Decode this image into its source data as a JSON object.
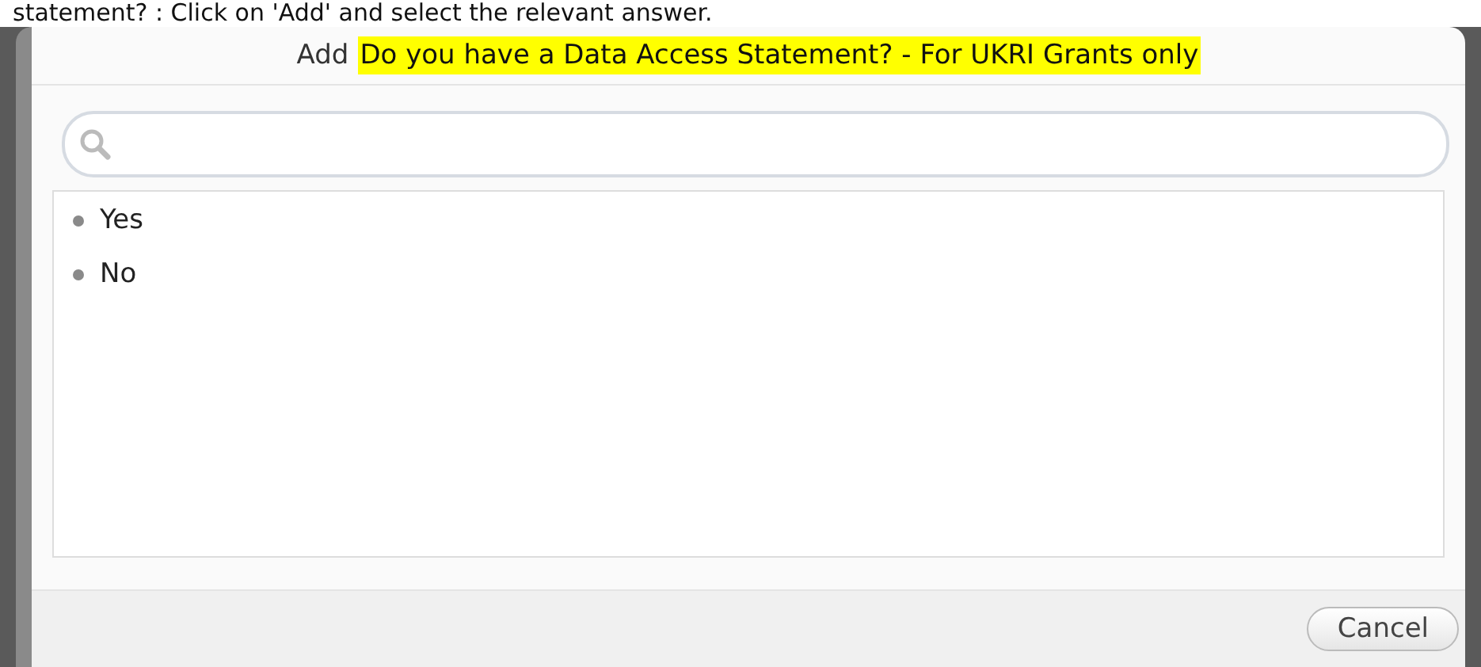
{
  "instruction": "statement? : Click on 'Add' and select the relevant answer.",
  "dialog": {
    "title_prefix": "Add",
    "title_highlight": "Do you have a Data Access Statement? - For UKRI Grants only",
    "options": [
      {
        "label": "Yes"
      },
      {
        "label": "No"
      }
    ],
    "buttons": [
      "Cancel"
    ]
  }
}
